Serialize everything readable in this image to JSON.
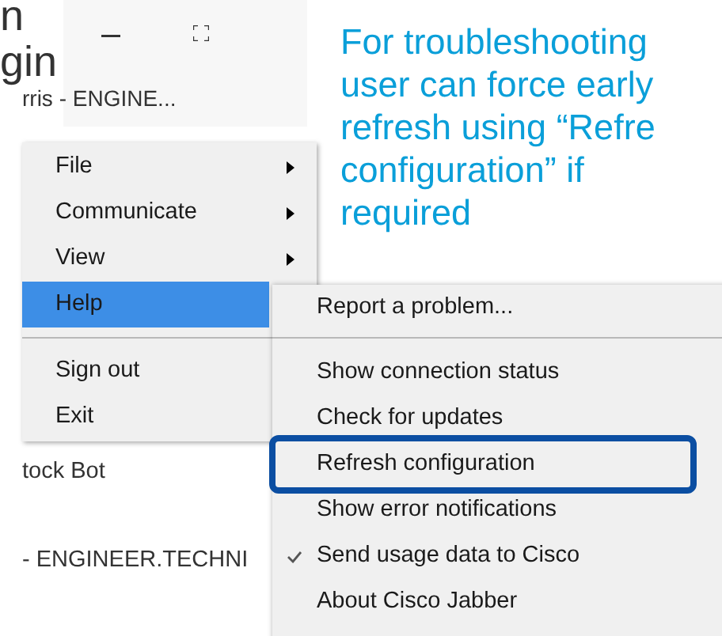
{
  "slide_title_fragment": [
    "n",
    "gin"
  ],
  "window": {
    "title": "rris - ENGINE..."
  },
  "menu": [
    {
      "kind": "item",
      "label": "File",
      "has_submenu": true,
      "selected": false
    },
    {
      "kind": "item",
      "label": "Communicate",
      "has_submenu": true,
      "selected": false
    },
    {
      "kind": "item",
      "label": "View",
      "has_submenu": true,
      "selected": false
    },
    {
      "kind": "item",
      "label": "Help",
      "has_submenu": false,
      "selected": true
    },
    {
      "kind": "separator"
    },
    {
      "kind": "item",
      "label": "Sign out",
      "has_submenu": false,
      "selected": false
    },
    {
      "kind": "item",
      "label": "Exit",
      "has_submenu": false,
      "selected": false
    }
  ],
  "background_items": [
    "tock Bot",
    "- ENGINEER.TECHNI"
  ],
  "submenu": [
    {
      "kind": "item",
      "label": "Report a problem...",
      "checked": false,
      "highlighted": false
    },
    {
      "kind": "separator"
    },
    {
      "kind": "item",
      "label": "Show connection status",
      "checked": false,
      "highlighted": false
    },
    {
      "kind": "item",
      "label": "Check for updates",
      "checked": false,
      "highlighted": false
    },
    {
      "kind": "item",
      "label": "Refresh configuration",
      "checked": false,
      "highlighted": true
    },
    {
      "kind": "item",
      "label": "Show error notifications",
      "checked": false,
      "highlighted": false
    },
    {
      "kind": "item",
      "label": "Send usage data to Cisco",
      "checked": true,
      "highlighted": false
    },
    {
      "kind": "item",
      "label": "About Cisco Jabber",
      "checked": false,
      "highlighted": false
    }
  ],
  "callout": [
    "For troubleshooting",
    "user can force early",
    "refresh using “Refre",
    "configuration” if",
    "required"
  ]
}
